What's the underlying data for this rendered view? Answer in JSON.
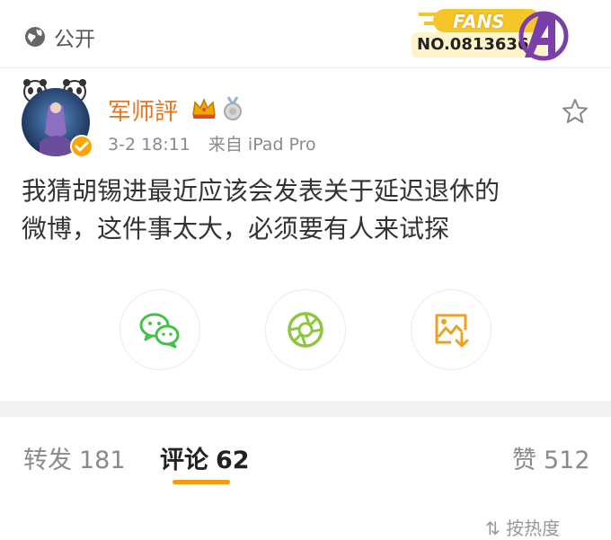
{
  "privacy": {
    "label": "公开",
    "icon": "globe-icon"
  },
  "fans_badge": {
    "title": "FANS",
    "number": "NO.0813636",
    "icon": "avengers-a-logo-icon"
  },
  "post": {
    "author": "军师評",
    "date": "3-2 18:11",
    "source": "来自 iPad Pro",
    "text_line1": "我猜胡锡进最近应该会发表关于延迟退休的",
    "text_line2": "微博，这件事太大，必须要有人来试探"
  },
  "share": {
    "buttons": [
      {
        "name": "wechat",
        "icon": "wechat-icon"
      },
      {
        "name": "moments",
        "icon": "moments-aperture-icon"
      },
      {
        "name": "save-image",
        "icon": "image-download-icon"
      }
    ]
  },
  "tabs": {
    "repost_label": "转发",
    "repost_count": "181",
    "comment_label": "评论",
    "comment_count": "62",
    "like_label": "赞",
    "like_count": "512"
  },
  "bottom_partial": "按热度",
  "colors": {
    "accent": "#f39c12",
    "username": "#e8741c",
    "wechat": "#45c14b"
  }
}
